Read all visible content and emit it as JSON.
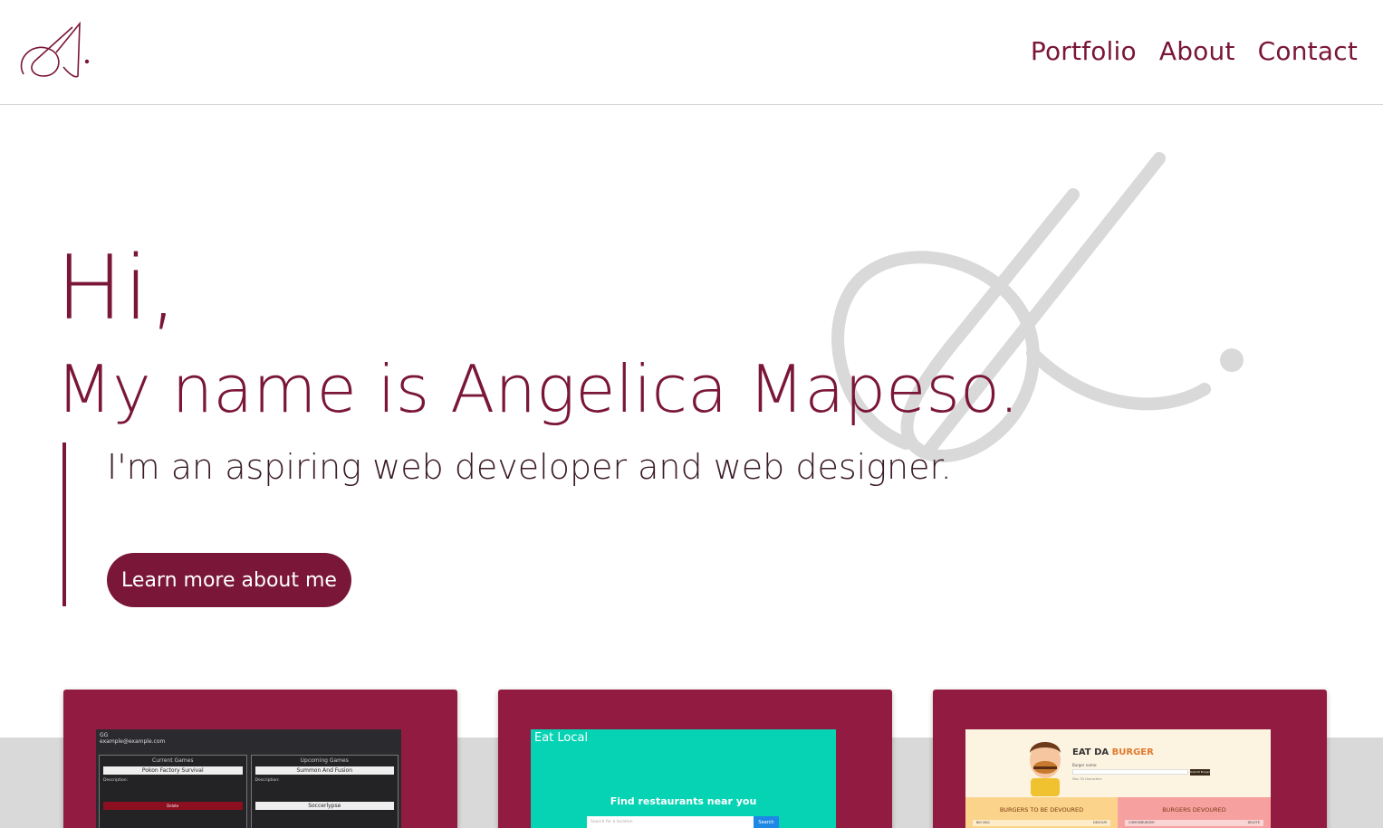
{
  "header": {
    "logo_alt": "A.",
    "nav": [
      {
        "label": "Portfolio"
      },
      {
        "label": "About"
      },
      {
        "label": "Contact"
      }
    ]
  },
  "hero": {
    "greeting": "Hi,",
    "name_line": "My name is Angelica Mapeso.",
    "tagline": "I'm an aspiring web developer and web designer.",
    "cta_label": "Learn more about me"
  },
  "portfolio": {
    "cards": [
      {
        "brand": "GG",
        "account": "example@example.com",
        "left_heading": "Current Games",
        "right_heading": "Upcoming Games",
        "left_game": "Pokon Factory Survival",
        "right_game": "Summon And Fusion",
        "right_game_2": "Soccerlypse",
        "desc_label": "Description:",
        "delete_label": "Delete"
      },
      {
        "brand": "Eat Local",
        "headline": "Find restaurants near you",
        "search_placeholder": "Search for a location",
        "search_button": "Search"
      },
      {
        "title_a": "EAT DA ",
        "title_b": "BURGER",
        "input_label": "Burger name:",
        "submit_label": "Submit Burger",
        "hint": "Max 30 characters",
        "panel_a": "BURGERS TO BE DEVOURED",
        "panel_b": "BURGERS DEVOURED",
        "panel_a_item": "BIG MAC",
        "panel_a_action": "DEVOUR",
        "panel_b_item": "CHEESEBURGER",
        "panel_b_action": "DELETE"
      }
    ]
  },
  "colors": {
    "brand": "#7a1638",
    "card": "#921c41",
    "watermark": "#d9d9d9"
  }
}
